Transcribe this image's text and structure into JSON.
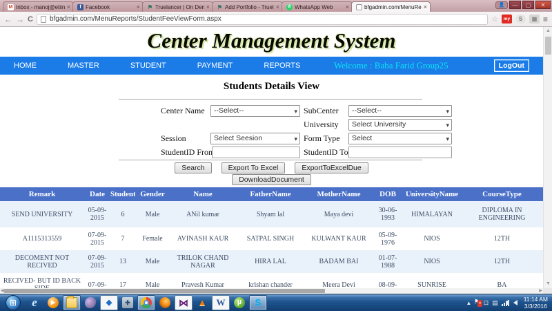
{
  "browser": {
    "tabs": [
      {
        "label": "Inbox - manoj@etiinfotec",
        "icon": "gmail",
        "glyph": "M",
        "active": false
      },
      {
        "label": "Facebook",
        "icon": "facebook",
        "glyph": "f",
        "active": false
      },
      {
        "label": "Truelancer | On Demand C",
        "icon": "truelancer",
        "glyph": "⚑",
        "active": false
      },
      {
        "label": "Add Portfolio - Truelancer",
        "icon": "truelancer",
        "glyph": "⚑",
        "active": false
      },
      {
        "label": "WhatsApp Web",
        "icon": "whatsapp",
        "glyph": "✆",
        "active": false
      },
      {
        "label": "bfgadmin.com/MenuRepo",
        "icon": "page",
        "glyph": "",
        "active": true
      }
    ],
    "window_controls": {
      "minimize": "—",
      "maximize": "▢",
      "close": "✕"
    },
    "url": "bfgadmin.com/MenuReports/StudentFeeViewForm.aspx",
    "address_icons": [
      "back-icon",
      "forward-icon",
      "reload-icon",
      "page-icon",
      "star-icon",
      "my-extension-icon",
      "skype-extension-icon",
      "extension-icon",
      "menu-icon"
    ],
    "address_glyphs": {
      "back": "←",
      "forward": "→",
      "reload": "C",
      "star": "☆",
      "my": "my",
      "skype": "S",
      "box": "▦",
      "menu": "≡"
    }
  },
  "site": {
    "title": "Center Management System",
    "heading": "Students Details View"
  },
  "nav": {
    "items": [
      "HOME",
      "MASTER",
      "STUDENT",
      "PAYMENT",
      "REPORTS"
    ],
    "welcome": "Welcome : Baba Farid Group25",
    "logout_label": "LogOut"
  },
  "filters": {
    "center_name": {
      "label": "Center Name",
      "value": "--Select--"
    },
    "subcenter": {
      "label": "SubCenter",
      "value": "--Select--"
    },
    "university": {
      "label": "University",
      "value": "Select University"
    },
    "session": {
      "label": "Session",
      "value": "Select Seesion"
    },
    "form_type": {
      "label": "Form Type",
      "value": "Select"
    },
    "studentid_from": {
      "label": "StudentID From",
      "value": ""
    },
    "studentid_to": {
      "label": "StudentID To",
      "value": ""
    }
  },
  "actions": {
    "search": "Search",
    "export_excel": "Export To Excel",
    "export_excel_due": "ExportToExcelDue",
    "download_document": "DownloadDocument"
  },
  "table": {
    "columns": [
      "Remark",
      "Date",
      "StudentID",
      "Gender",
      "Name",
      "FatherName",
      "MotherName",
      "DOB",
      "UniversityName",
      "CourseType"
    ],
    "rows": [
      [
        "SEND UNIVERSITY",
        "05-09-2015",
        "6",
        "Male",
        "ANil kumar",
        "Shyam lal",
        "Maya devi",
        "30-06-1993",
        "HIMALAYAN",
        "DIPLOMA IN ENGINEERING"
      ],
      [
        "A1115313559",
        "07-09-2015",
        "7",
        "Female",
        "AVINASH KAUR",
        "SATPAL SINGH",
        "KULWANT KAUR",
        "05-09-1976",
        "NIOS",
        "12TH"
      ],
      [
        "DECOMENT NOT RECIVED",
        "07-09-2015",
        "13",
        "Male",
        "TRILOK CHAND NAGAR",
        "HIRA LAL",
        "BADAM BAI",
        "01-07-1988",
        "NIOS",
        "12TH"
      ],
      [
        "RECIVED- BUT ID BACK SIDE",
        "07-09-",
        "17",
        "Male",
        "Pravesh Kumar",
        "krishan chander",
        "Meera Devi",
        "08-09-",
        "SUNRISE",
        "BA"
      ]
    ]
  },
  "taskbar": {
    "icons": [
      {
        "name": "start",
        "glyph": "⊞",
        "open": false
      },
      {
        "name": "ie",
        "glyph": "e",
        "open": false
      },
      {
        "name": "wmp",
        "glyph": "▶",
        "open": false
      },
      {
        "name": "explorer",
        "glyph": "",
        "open": true
      },
      {
        "name": "dolphin",
        "glyph": "",
        "open": false
      },
      {
        "name": "dropbox",
        "glyph": "◆",
        "open": true
      },
      {
        "name": "security",
        "glyph": "✚",
        "open": false
      },
      {
        "name": "chrome",
        "glyph": "",
        "open": true
      },
      {
        "name": "firefox",
        "glyph": "",
        "open": false
      },
      {
        "name": "vs",
        "glyph": "⋈",
        "open": true
      },
      {
        "name": "vlc",
        "glyph": "▲",
        "open": false
      },
      {
        "name": "word",
        "glyph": "W",
        "open": true
      },
      {
        "name": "utorrent",
        "glyph": "µ",
        "open": false
      },
      {
        "name": "skype",
        "glyph": "S",
        "open": true
      }
    ],
    "tray_glyphs": {
      "expand": "▴",
      "flag": "⚑",
      "misc1": "⊡",
      "misc2": "▤"
    },
    "clock": {
      "time": "11:14 AM",
      "date": "3/3/2016"
    }
  },
  "colors": {
    "nav_blue": "#1b7ce8",
    "welcome_aqua": "#0ce4f2",
    "grid_header_blue": "#4a70c8",
    "grid_alt_row": "#e9f1fb",
    "grid_text": "#3d4c63",
    "title_glow": "#cfe6a0",
    "tabstrip_pink": "#c2a0a5",
    "taskbar_blue": "#1f538d"
  }
}
